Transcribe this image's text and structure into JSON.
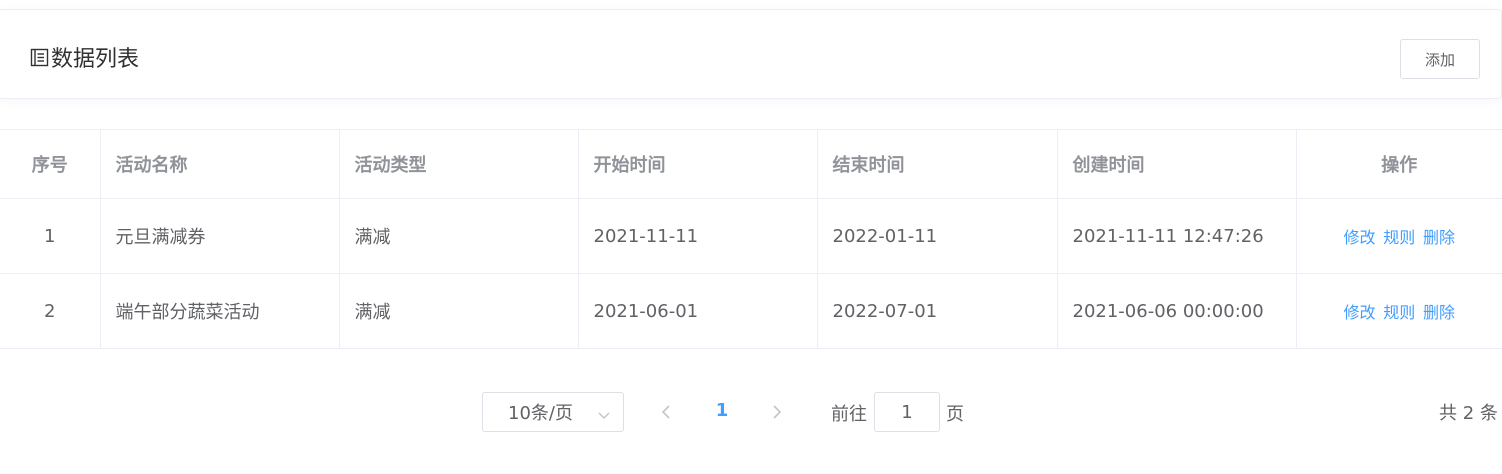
{
  "header": {
    "icon": "list-icon",
    "title": "数据列表",
    "add_label": "添加"
  },
  "table": {
    "columns": [
      "序号",
      "活动名称",
      "活动类型",
      "开始时间",
      "结束时间",
      "创建时间",
      "操作"
    ],
    "rows": [
      {
        "index": "1",
        "name": "元旦满减券",
        "type": "满减",
        "start": "2021-11-11",
        "end": "2022-01-11",
        "created": "2021-11-11 12:47:26",
        "actions": [
          "修改",
          "规则",
          "删除"
        ]
      },
      {
        "index": "2",
        "name": "端午部分蔬菜活动",
        "type": "满减",
        "start": "2021-06-01",
        "end": "2022-07-01",
        "created": "2021-06-06 00:00:00",
        "actions": [
          "修改",
          "规则",
          "删除"
        ]
      }
    ]
  },
  "pagination": {
    "page_size": "10条/页",
    "current_page": "1",
    "goto_prefix": "前往",
    "goto_value": "1",
    "goto_suffix": "页",
    "total_text": "共 2 条"
  },
  "colors": {
    "link": "#409eff",
    "border": "#ebeef5",
    "header_text": "#909399",
    "body_text": "#606266"
  }
}
